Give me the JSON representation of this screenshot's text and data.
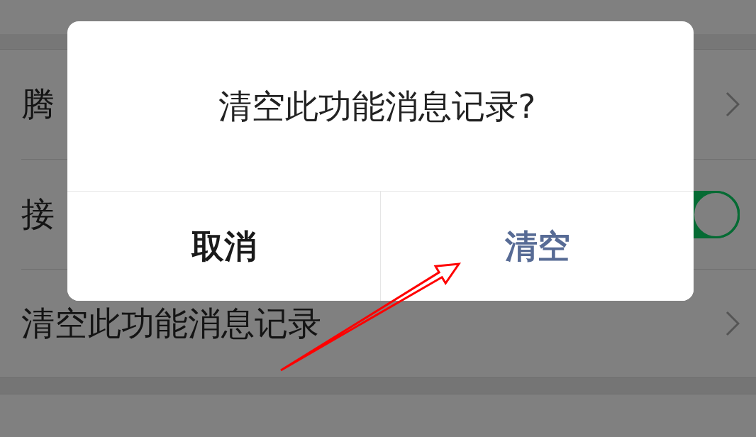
{
  "settings_list": [
    {
      "kind": "link",
      "label": "腾"
    },
    {
      "kind": "toggle",
      "label": "接",
      "on": true
    },
    {
      "kind": "link",
      "label": "清空此功能消息记录"
    }
  ],
  "dialog": {
    "title": "清空此功能消息记录?",
    "buttons": [
      {
        "kind": "cancel",
        "label": "取消"
      },
      {
        "kind": "primary",
        "label": "清空"
      }
    ]
  },
  "annotations": [
    {
      "kind": "arrow"
    }
  ]
}
